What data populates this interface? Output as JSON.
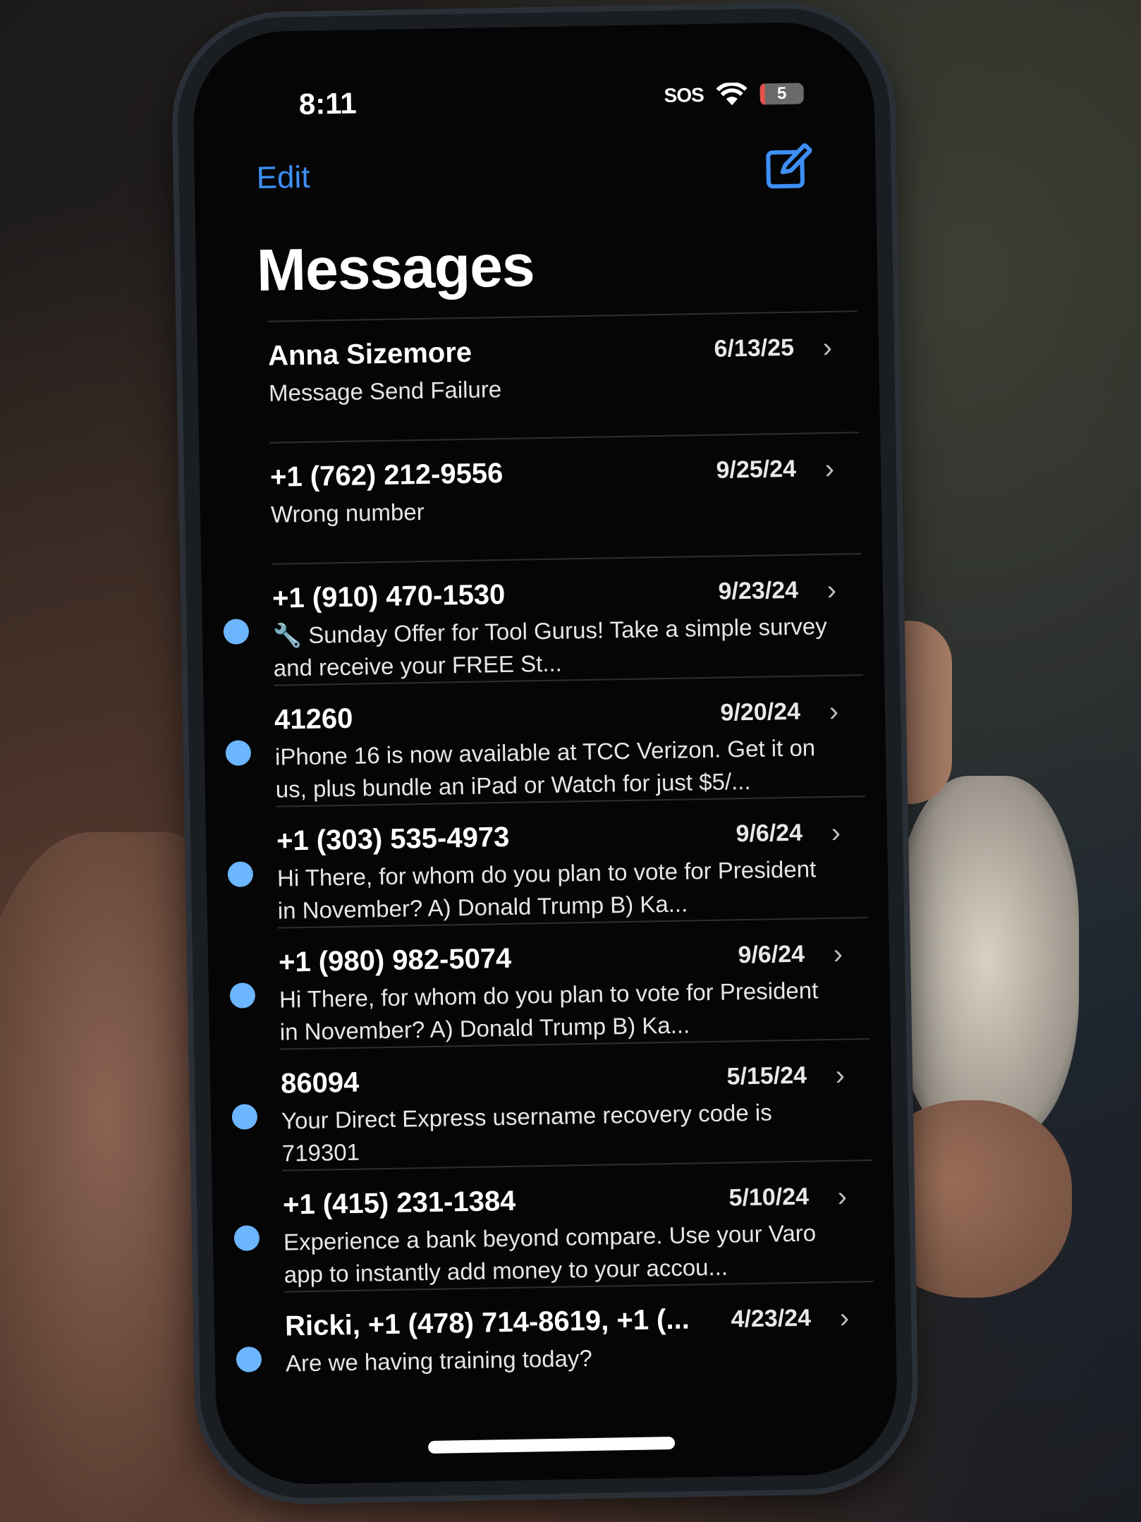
{
  "colors": {
    "accent": "#3d8ff5",
    "unread_dot": "#6bb6ff",
    "background": "#050505",
    "battery_low": "#e5524a"
  },
  "status_bar": {
    "time": "8:11",
    "carrier": "SOS",
    "battery_level": "5"
  },
  "nav": {
    "edit_label": "Edit",
    "compose_icon": "compose-icon"
  },
  "page": {
    "title": "Messages"
  },
  "conversations": [
    {
      "name": "Anna Sizemore",
      "date": "6/13/25",
      "preview": "Message Send Failure",
      "unread": false
    },
    {
      "name": "+1 (762) 212-9556",
      "date": "9/25/24",
      "preview": "Wrong number",
      "unread": false
    },
    {
      "name": "+1 (910) 470-1530",
      "date": "9/23/24",
      "preview": "🔧 Sunday Offer for Tool Gurus! Take a simple survey and receive your FREE St...",
      "unread": true
    },
    {
      "name": "41260",
      "date": "9/20/24",
      "preview": "iPhone 16 is now available at TCC Verizon. Get it on us, plus bundle an iPad or Watch for just $5/...",
      "unread": true
    },
    {
      "name": "+1 (303) 535-4973",
      "date": "9/6/24",
      "preview": "Hi There, for whom do you plan to vote for President in November? A) Donald Trump B) Ka...",
      "unread": true
    },
    {
      "name": "+1 (980) 982-5074",
      "date": "9/6/24",
      "preview": "Hi There, for whom do you plan to vote for President in November? A) Donald Trump B) Ka...",
      "unread": true
    },
    {
      "name": "86094",
      "date": "5/15/24",
      "preview": "Your Direct Express username recovery code is 719301",
      "unread": true
    },
    {
      "name": "+1 (415) 231-1384",
      "date": "5/10/24",
      "preview": "Experience a bank beyond compare. Use your Varo app to instantly add money to your accou...",
      "unread": true
    },
    {
      "name": "Ricki, +1 (478) 714-8619, +1 (...",
      "date": "4/23/24",
      "preview": "Are we having training today?",
      "unread": true
    }
  ]
}
